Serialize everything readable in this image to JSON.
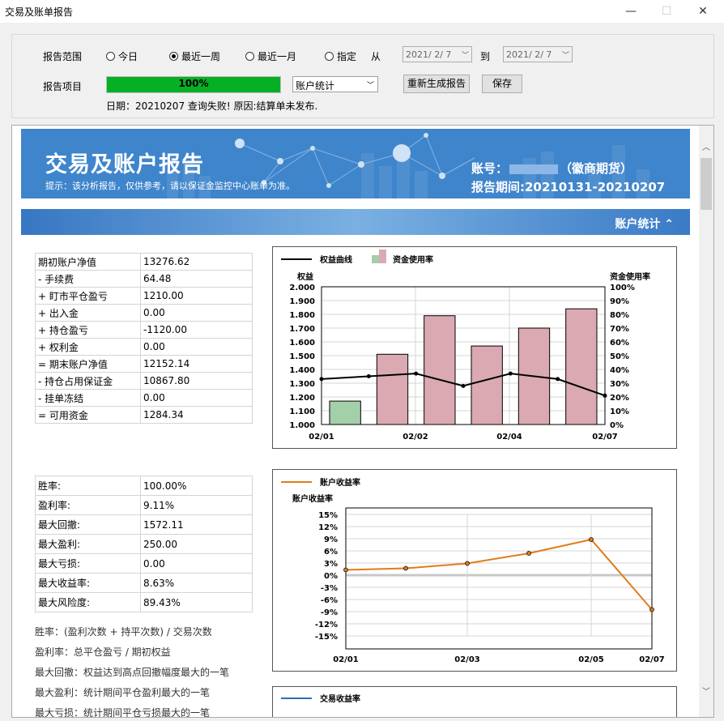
{
  "window": {
    "title": "交易及账单报告",
    "minimize": "—",
    "maximize": "☐",
    "close": "✕"
  },
  "controls": {
    "range_label": "报告范围",
    "radios": [
      {
        "label": "今日",
        "checked": false
      },
      {
        "label": "最近一周",
        "checked": true
      },
      {
        "label": "最近一月",
        "checked": false
      },
      {
        "label": "指定",
        "checked": false
      }
    ],
    "from_label": "从",
    "from_date": "2021/ 2/ 7",
    "to_label": "到",
    "to_date": "2021/ 2/ 7",
    "item_label": "报告项目",
    "progress": 1.0,
    "progress_text": "100%",
    "select_value": "账户统计",
    "regen_button": "重新生成报告",
    "save_button": "保存",
    "status": "日期：20210207 查询失败! 原因:结算单未发布."
  },
  "banner": {
    "title": "交易及账户报告",
    "subtitle": "提示：该分析报告，仅供参考，请以保证金监控中心账单为准。",
    "account_prefix": "账号：",
    "account_suffix": "（徽商期货）",
    "period": "报告期间:20210131-20210207"
  },
  "section": {
    "title": "账户统计"
  },
  "account_table": [
    {
      "k": "期初账户净值",
      "v": "13276.62"
    },
    {
      "k": "- 手续费",
      "v": "64.48"
    },
    {
      "k": "+ 盯市平仓盈亏",
      "v": "1210.00"
    },
    {
      "k": "+ 出入金",
      "v": "0.00"
    },
    {
      "k": "+ 持仓盈亏",
      "v": "-1120.00"
    },
    {
      "k": "+ 权利金",
      "v": "0.00"
    },
    {
      "k": "= 期末账户净值",
      "v": "12152.14"
    },
    {
      "k": "- 持仓占用保证金",
      "v": "10867.80"
    },
    {
      "k": "- 挂单冻结",
      "v": "0.00"
    },
    {
      "k": "= 可用资金",
      "v": "1284.34"
    }
  ],
  "stats_table": [
    {
      "k": "胜率:",
      "v": "100.00%"
    },
    {
      "k": "盈利率:",
      "v": "9.11%"
    },
    {
      "k": "最大回撤:",
      "v": "1572.11"
    },
    {
      "k": "最大盈利:",
      "v": "250.00"
    },
    {
      "k": "最大亏损:",
      "v": "0.00"
    },
    {
      "k": "最大收益率:",
      "v": "8.63%"
    },
    {
      "k": "最大风险度:",
      "v": "89.43%"
    }
  ],
  "notes": [
    "胜率：(盈利次数 + 持平次数) / 交易次数",
    "盈利率：总平仓盈亏 / 期初权益",
    "最大回撤：权益达到高点回撤幅度最大的一笔",
    "最大盈利：统计期间平仓盈利最大的一笔",
    "最大亏损：统计期间平仓亏损最大的一笔"
  ],
  "chart_data": [
    {
      "type": "bar",
      "legend": [
        "权益曲线",
        "资金使用率"
      ],
      "ylabel": "权益",
      "y2label": "资金使用率",
      "yticks": [
        "2.000",
        "1.900",
        "1.800",
        "1.700",
        "1.600",
        "1.500",
        "1.400",
        "1.300",
        "1.200",
        "1.100",
        "1.000"
      ],
      "y2ticks": [
        "100%",
        "90%",
        "80%",
        "70%",
        "60%",
        "50%",
        "40%",
        "30%",
        "20%",
        "10%",
        "0%"
      ],
      "xticks": [
        "02/01",
        "02/02",
        "02/04",
        "02/07"
      ],
      "ylim": [
        1.0,
        2.0
      ],
      "y2lim": [
        0,
        100
      ],
      "bars": [
        {
          "value": 17,
          "color": "#a3cfa9"
        },
        {
          "value": 51,
          "color": "#dba9b2"
        },
        {
          "value": 79,
          "color": "#dba9b2"
        },
        {
          "value": 57,
          "color": "#dba9b2"
        },
        {
          "value": 70,
          "color": "#dba9b2"
        },
        {
          "value": 84,
          "color": "#dba9b2"
        }
      ],
      "line": [
        1.33,
        1.35,
        1.37,
        1.28,
        1.37,
        1.33,
        1.21
      ]
    },
    {
      "type": "line",
      "legend": [
        "账户收益率"
      ],
      "ylabel": "账户收益率",
      "yticks": [
        "15%",
        "12%",
        "9%",
        "6%",
        "3%",
        "0%",
        "-3%",
        "-6%",
        "-9%",
        "-12%",
        "-15%"
      ],
      "xticks": [
        "02/01",
        "02/03",
        "02/05",
        "02/07"
      ],
      "ylim": [
        -15,
        15
      ],
      "values": [
        1.3,
        1.7,
        2.9,
        5.4,
        8.8,
        -8.5
      ],
      "color": "#e07b1a"
    },
    {
      "type": "line",
      "legend": [
        "交易收益率"
      ]
    }
  ]
}
